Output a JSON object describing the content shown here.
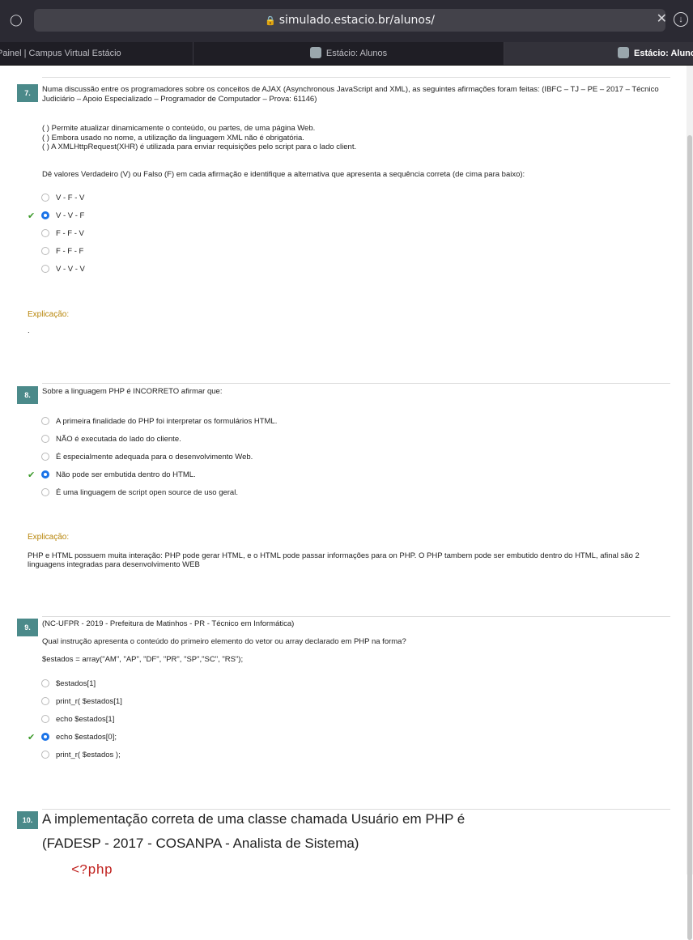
{
  "browser": {
    "url": "simulado.estacio.br/alunos/",
    "tabs": [
      "Painel | Campus Virtual Estácio",
      "Estácio: Alunos",
      "Estácio: Alunos"
    ]
  },
  "questions": [
    {
      "number": "7.",
      "statement": "Numa discussão entre os programadores sobre os conceitos de AJAX (Asynchronous JavaScript and XML), as seguintes afirmações foram feitas: (IBFC – TJ – PE – 2017 – Técnico Judiciário – Apoio Especializado – Programador de Computador – Prova: 61146)",
      "items": [
        "( ) Permite atualizar dinamicamente o conteúdo, ou partes, de uma página Web.",
        "( ) Embora usado no nome, a utilização da linguagem XML não é obrigatória.",
        "( ) A XMLHttpRequest(XHR) é utilizada para enviar requisições pelo script para o lado client."
      ],
      "instruction": "Dê valores Verdadeiro (V) ou Falso (F) em cada afirmação e identifique a alternativa que apresenta a sequência correta (de cima para baixo):",
      "options": [
        "V - F - V",
        "V - V - F",
        "F - F - V",
        "F - F - F",
        "V - V - V"
      ],
      "selected": 1,
      "explanation_label": "Explicação:",
      "explanation": "."
    },
    {
      "number": "8.",
      "statement": "Sobre a linguagem PHP é INCORRETO afirmar que:",
      "options": [
        "A primeira finalidade do PHP foi interpretar os formulários HTML.",
        "NÃO é executada do lado do cliente.",
        "É especialmente adequada para o desenvolvimento Web.",
        "Não pode ser embutida dentro do HTML.",
        "É uma linguagem de script open source de uso geral."
      ],
      "selected": 3,
      "explanation_label": "Explicação:",
      "explanation": "PHP e HTML possuem muita interação: PHP pode gerar HTML, e o HTML pode passar informações para on PHP. O PHP tambem pode ser embutido dentro do HTML, afinal são 2 linguagens integradas para desenvolvimento WEB"
    },
    {
      "number": "9.",
      "statement": "(NC-UFPR - 2019 - Prefeitura de Matinhos - PR - Técnico em Informática)",
      "statement2": "Qual instrução apresenta o conteúdo do primeiro elemento do vetor ou array declarado em PHP na forma?",
      "code": "$estados = array(\"AM\", \"AP\", \"DF\", \"PR\", \"SP\",\"SC\", \"RS\");",
      "options": [
        "$estados[1]",
        "print_r( $estados[1]",
        "echo  $estados[1]",
        "echo $estados[0];",
        "print_r( $estados );"
      ],
      "selected": 3
    },
    {
      "number": "10.",
      "statement": "A implementação correta de uma classe chamada Usuário em PHP é",
      "statement2": "(FADESP - 2017 - COSANPA - Analista de Sistema)",
      "code": "<?php"
    }
  ],
  "icons": {
    "correct": "check-icon",
    "colors": {
      "accent": "#1a73e8",
      "correct": "#3c9a2a",
      "badge": "#4b8a8a",
      "explanation": "#b8860b"
    }
  }
}
